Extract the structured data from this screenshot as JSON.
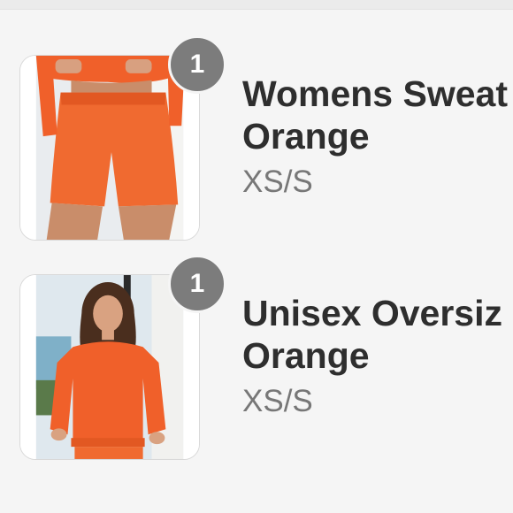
{
  "cart": {
    "items": [
      {
        "quantity": "1",
        "title_line1": "Womens Sweat",
        "title_line2": "Orange",
        "variant": "XS/S",
        "thumbnail_icon": "orange-shorts-product-image"
      },
      {
        "quantity": "1",
        "title_line1": "Unisex Oversiz",
        "title_line2": "Orange",
        "variant": "XS/S",
        "thumbnail_icon": "orange-sweatshirt-product-image"
      }
    ]
  },
  "colors": {
    "background": "#f5f5f5",
    "badge": "#7c7c7c",
    "title_text": "#2e2e2e",
    "variant_text": "#777777",
    "product_orange": "#f0602a"
  }
}
